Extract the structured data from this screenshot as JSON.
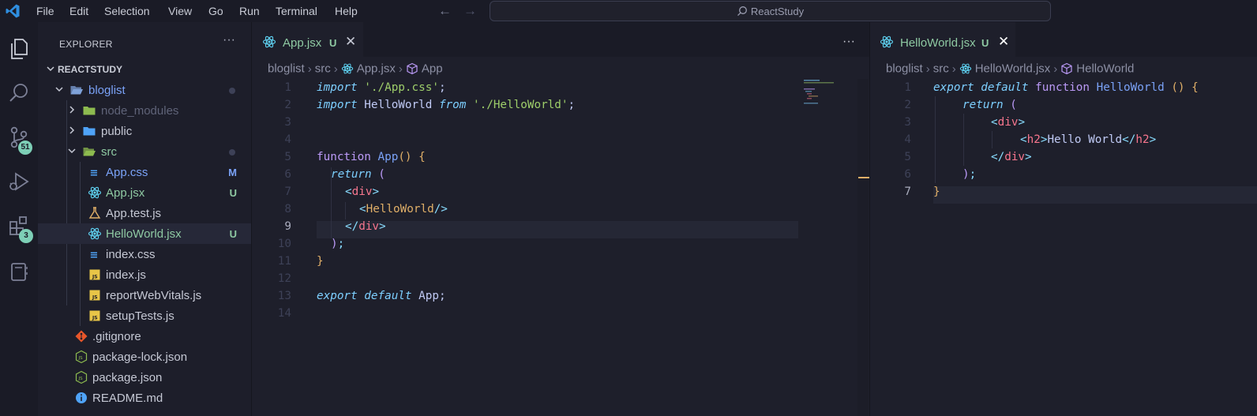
{
  "menu": [
    "File",
    "Edit",
    "Selection",
    "View",
    "Go",
    "Run",
    "Terminal",
    "Help"
  ],
  "command_center": {
    "label": "ReactStudy"
  },
  "activity_bar": {
    "icons": [
      "explorer-icon",
      "search-icon",
      "source-control-icon",
      "run-debug-icon",
      "extensions-icon",
      "notebook-icon"
    ],
    "source_control_badge": "51",
    "extensions_badge": "3"
  },
  "explorer": {
    "title": "EXPLORER",
    "more": "···",
    "project": "REACTSTUDY",
    "items": [
      {
        "label": "bloglist",
        "type": "folder-open",
        "status": "dot",
        "color": "#7aa2f7"
      },
      {
        "label": "node_modules",
        "type": "folder",
        "status": "",
        "color": "#5f6378"
      },
      {
        "label": "public",
        "type": "folder",
        "status": "",
        "color": "#c5c8d4"
      },
      {
        "label": "src",
        "type": "folder-open",
        "status": "dot",
        "color": "#8fcaa3"
      },
      {
        "label": "App.css",
        "type": "file",
        "status": "M",
        "color": "#7aa2f7"
      },
      {
        "label": "App.jsx",
        "type": "file",
        "status": "U",
        "color": "#8fcaa3"
      },
      {
        "label": "App.test.js",
        "type": "file",
        "status": "",
        "color": "#c5c8d4"
      },
      {
        "label": "HelloWorld.jsx",
        "type": "file",
        "status": "U",
        "color": "#8fcaa3"
      },
      {
        "label": "index.css",
        "type": "file",
        "status": "",
        "color": "#c5c8d4"
      },
      {
        "label": "index.js",
        "type": "file",
        "status": "",
        "color": "#c5c8d4"
      },
      {
        "label": "reportWebVitals.js",
        "type": "file",
        "status": "",
        "color": "#c5c8d4"
      },
      {
        "label": "setupTests.js",
        "type": "file",
        "status": "",
        "color": "#c5c8d4"
      },
      {
        "label": ".gitignore",
        "type": "file",
        "status": "",
        "color": "#c5c8d4"
      },
      {
        "label": "package-lock.json",
        "type": "file",
        "status": "",
        "color": "#c5c8d4"
      },
      {
        "label": "package.json",
        "type": "file",
        "status": "",
        "color": "#c5c8d4"
      },
      {
        "label": "README.md",
        "type": "file",
        "status": "",
        "color": "#c5c8d4"
      }
    ]
  },
  "left_editor": {
    "tab": {
      "label": "App.jsx",
      "status": "U",
      "close": "✕"
    },
    "more": "···",
    "breadcrumb": [
      "bloglist",
      "src",
      "App.jsx",
      "App"
    ],
    "active_line": 9,
    "lines": [
      "1",
      "2",
      "3",
      "4",
      "5",
      "6",
      "7",
      "8",
      "9",
      "10",
      "11",
      "12",
      "13",
      "14"
    ]
  },
  "right_editor": {
    "tab": {
      "label": "HelloWorld.jsx",
      "status": "U",
      "close": "✕"
    },
    "breadcrumb": [
      "bloglist",
      "src",
      "HelloWorld.jsx",
      "HelloWorld"
    ],
    "active_line": 7,
    "lines": [
      "1",
      "2",
      "3",
      "4",
      "5",
      "6",
      "7"
    ]
  },
  "code": {
    "app": {
      "l1": [
        "import",
        " ",
        "'./App.css'",
        ";"
      ],
      "l2": [
        "import",
        " HelloWorld ",
        "from",
        " ",
        "'./HelloWorld'",
        ";"
      ],
      "l5": [
        "function",
        " ",
        "App",
        "()",
        " ",
        "{"
      ],
      "l6": [
        "return",
        " ",
        "("
      ],
      "l7": [
        "<",
        "div",
        ">"
      ],
      "l8": [
        "<",
        "HelloWorld",
        "/>"
      ],
      "l9": [
        "</",
        "div",
        ">"
      ],
      "l10": [
        ")",
        ";"
      ],
      "l11": [
        "}"
      ],
      "l13": [
        "export",
        " ",
        "default",
        " App;"
      ]
    },
    "hello": {
      "l1": [
        "export",
        " ",
        "default",
        " ",
        "function",
        " ",
        "HelloWorld",
        " ",
        "()",
        " ",
        "{"
      ],
      "l2": [
        "return",
        " ",
        "("
      ],
      "l3": [
        "<",
        "div",
        ">"
      ],
      "l4": [
        "<",
        "h2",
        ">",
        "Hello World",
        "</",
        "h2",
        ">"
      ],
      "l5": [
        "</",
        "div",
        ">"
      ],
      "l6": [
        ")",
        ";"
      ],
      "l7": [
        "}"
      ]
    }
  }
}
